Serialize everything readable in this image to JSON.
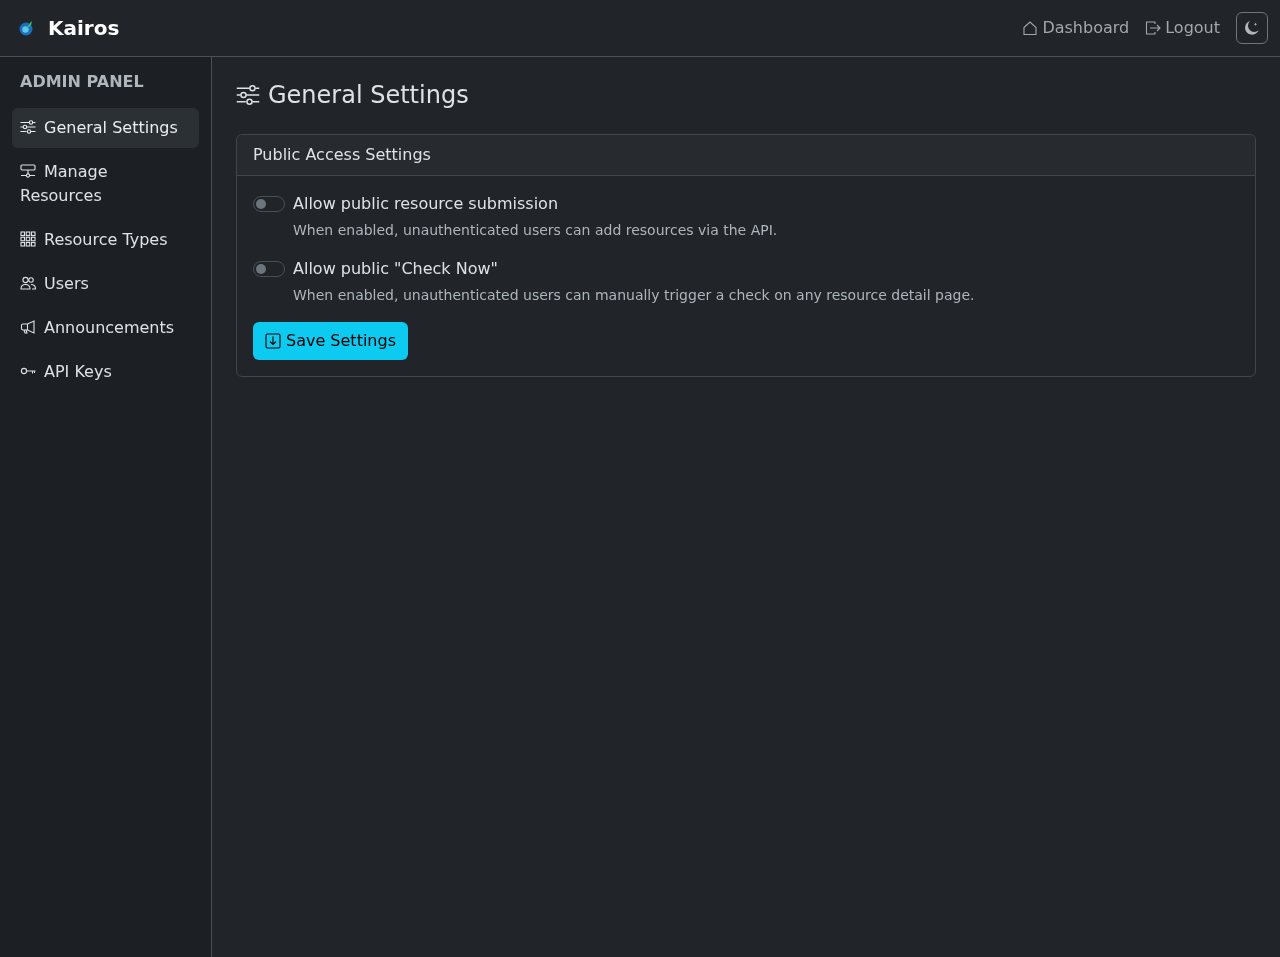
{
  "brand": {
    "name": "Kairos"
  },
  "nav_links": [
    {
      "kind": "home",
      "label": "Dashboard"
    },
    {
      "kind": "logout",
      "label": "Logout"
    }
  ],
  "sidebar": {
    "heading": "ADMIN PANEL",
    "items": [
      {
        "kind": "sliders",
        "label": "General Settings",
        "selected": true
      },
      {
        "kind": "network",
        "label": "Manage Resources",
        "selected": false
      },
      {
        "kind": "grid",
        "label": "Resource Types",
        "selected": false
      },
      {
        "kind": "people",
        "label": "Users",
        "selected": false
      },
      {
        "kind": "megaphone",
        "label": "Announcements",
        "selected": false
      },
      {
        "kind": "key",
        "label": "API Keys",
        "selected": false
      }
    ]
  },
  "page": {
    "title": "General Settings",
    "card": {
      "title": "Public Access Settings",
      "settings": [
        {
          "label": "Allow public resource submission",
          "description": "When enabled, unauthenticated users can add resources via the API.",
          "on": false
        },
        {
          "label": "Allow public \"Check Now\"",
          "description": "When enabled, unauthenticated users can manually trigger a check on any resource detail page.",
          "on": false
        }
      ],
      "save_button": "Save Settings"
    }
  }
}
